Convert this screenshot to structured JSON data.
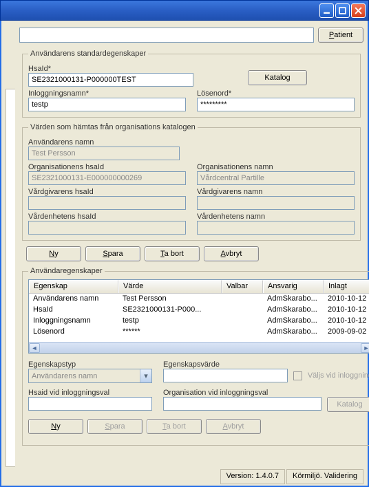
{
  "toolbar": {
    "patient_label": "Patient"
  },
  "section1": {
    "legend": "Användarens standardegenskaper",
    "hsaid_label": "HsaId*",
    "hsaid_value": "SE2321000131-P000000TEST",
    "katalog_label": "Katalog",
    "login_label": "Inloggningsnamn*",
    "login_value": "testp",
    "password_label": "Lösenord*",
    "password_value": "*********"
  },
  "section2": {
    "legend": "Värden som hämtas från organisations katalogen",
    "user_name_label": "Användarens namn",
    "user_name_value": "Test Persson",
    "org_hsaid_label": "Organisationens hsaId",
    "org_hsaid_value": "SE2321000131-E000000000269",
    "org_name_label": "Organisationens namn",
    "org_name_value": "Vårdcentral Partille",
    "caregiver_hsaid_label": "Vårdgivarens hsaId",
    "caregiver_name_label": "Vårdgivarens namn",
    "careunit_hsaid_label": "Vårdenhetens hsaId",
    "careunit_name_label": "Vårdenhetens namn"
  },
  "buttons1": {
    "ny": "Ny",
    "spara": "Spara",
    "tabort": "Ta bort",
    "avbryt": "Avbryt"
  },
  "section3": {
    "legend": "Användaregenskaper",
    "headers": [
      "Egenskap",
      "Värde",
      "Valbar",
      "Ansvarig",
      "Inlagt"
    ],
    "rows": [
      {
        "c1": "Användarens namn",
        "c2": "Test Persson",
        "c3": "",
        "c4": "AdmSkarabo...",
        "c5": "2010-10-12"
      },
      {
        "c1": "HsaId",
        "c2": "SE2321000131-P000...",
        "c3": "",
        "c4": "AdmSkarabo...",
        "c5": "2010-10-12"
      },
      {
        "c1": "Inloggningsnamn",
        "c2": "testp",
        "c3": "",
        "c4": "AdmSkarabo...",
        "c5": "2010-10-12"
      },
      {
        "c1": "Lösenord",
        "c2": "******",
        "c3": "",
        "c4": "AdmSkarabo...",
        "c5": "2009-09-02"
      }
    ],
    "proptype_label": "Egenskapstyp",
    "proptype_value": "Användarens namn",
    "propval_label": "Egenskapsvärde",
    "select_login_label": "Väljs vid inloggning",
    "hsaid_login_label": "Hsaid vid inloggningsval",
    "org_login_label": "Organisation vid inloggningsval",
    "katalog_label": "Katalog"
  },
  "buttons2": {
    "ny": "Ny",
    "spara": "Spara",
    "tabort": "Ta bort",
    "avbryt": "Avbryt"
  },
  "status": {
    "version": "Version: 1.4.0.7",
    "env": "Körmiljö. Validering"
  }
}
